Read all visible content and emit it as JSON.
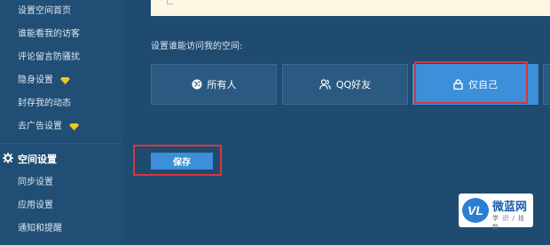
{
  "sidebar": {
    "items": [
      {
        "label": "设置空间首页",
        "vip": false
      },
      {
        "label": "谁能看我的访客",
        "vip": false
      },
      {
        "label": "评论留言防骚扰",
        "vip": false
      },
      {
        "label": "隐身设置",
        "vip": true
      },
      {
        "label": "封存我的动态",
        "vip": false
      },
      {
        "label": "去广告设置",
        "vip": true
      }
    ],
    "section_title": "空间设置",
    "sub_items": [
      {
        "label": "同步设置"
      },
      {
        "label": "应用设置"
      },
      {
        "label": "通知和提醒"
      }
    ]
  },
  "main": {
    "access_label": "设置谁能访问我的空间:",
    "options": [
      {
        "label": "所有人",
        "icon": "globe-icon",
        "selected": false
      },
      {
        "label": "QQ好友",
        "icon": "friends-icon",
        "selected": false
      },
      {
        "label": "仅自己",
        "icon": "lock-icon",
        "selected": true
      }
    ],
    "save_label": "保存"
  },
  "watermark": {
    "badge": "VL",
    "name": "微蓝网",
    "sub": "学 识 / 技 能"
  },
  "colors": {
    "background": "#1f4b70",
    "selected": "#3c8fd8",
    "highlight": "#d9363b",
    "vip": "#f5c518"
  }
}
